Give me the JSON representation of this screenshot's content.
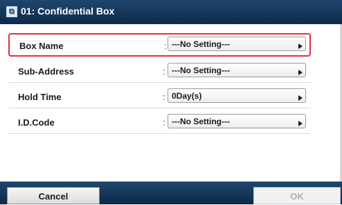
{
  "header": {
    "title": "01: Confidential Box",
    "icon": "box-icon"
  },
  "rows": [
    {
      "label": "Box Name",
      "colon": ":",
      "value": "---No Setting---",
      "selected": true
    },
    {
      "label": "Sub-Address",
      "colon": ":",
      "value": "---No Setting---",
      "selected": false
    },
    {
      "label": "Hold Time",
      "colon": ":",
      "value": "0Day(s)",
      "selected": false
    },
    {
      "label": "I.D.Code",
      "colon": ":",
      "value": "---No Setting---",
      "selected": false
    }
  ],
  "footer": {
    "cancel_label": "Cancel",
    "ok_label": "OK"
  },
  "colors": {
    "header": "#1b3e66",
    "selection": "#e0303a"
  }
}
